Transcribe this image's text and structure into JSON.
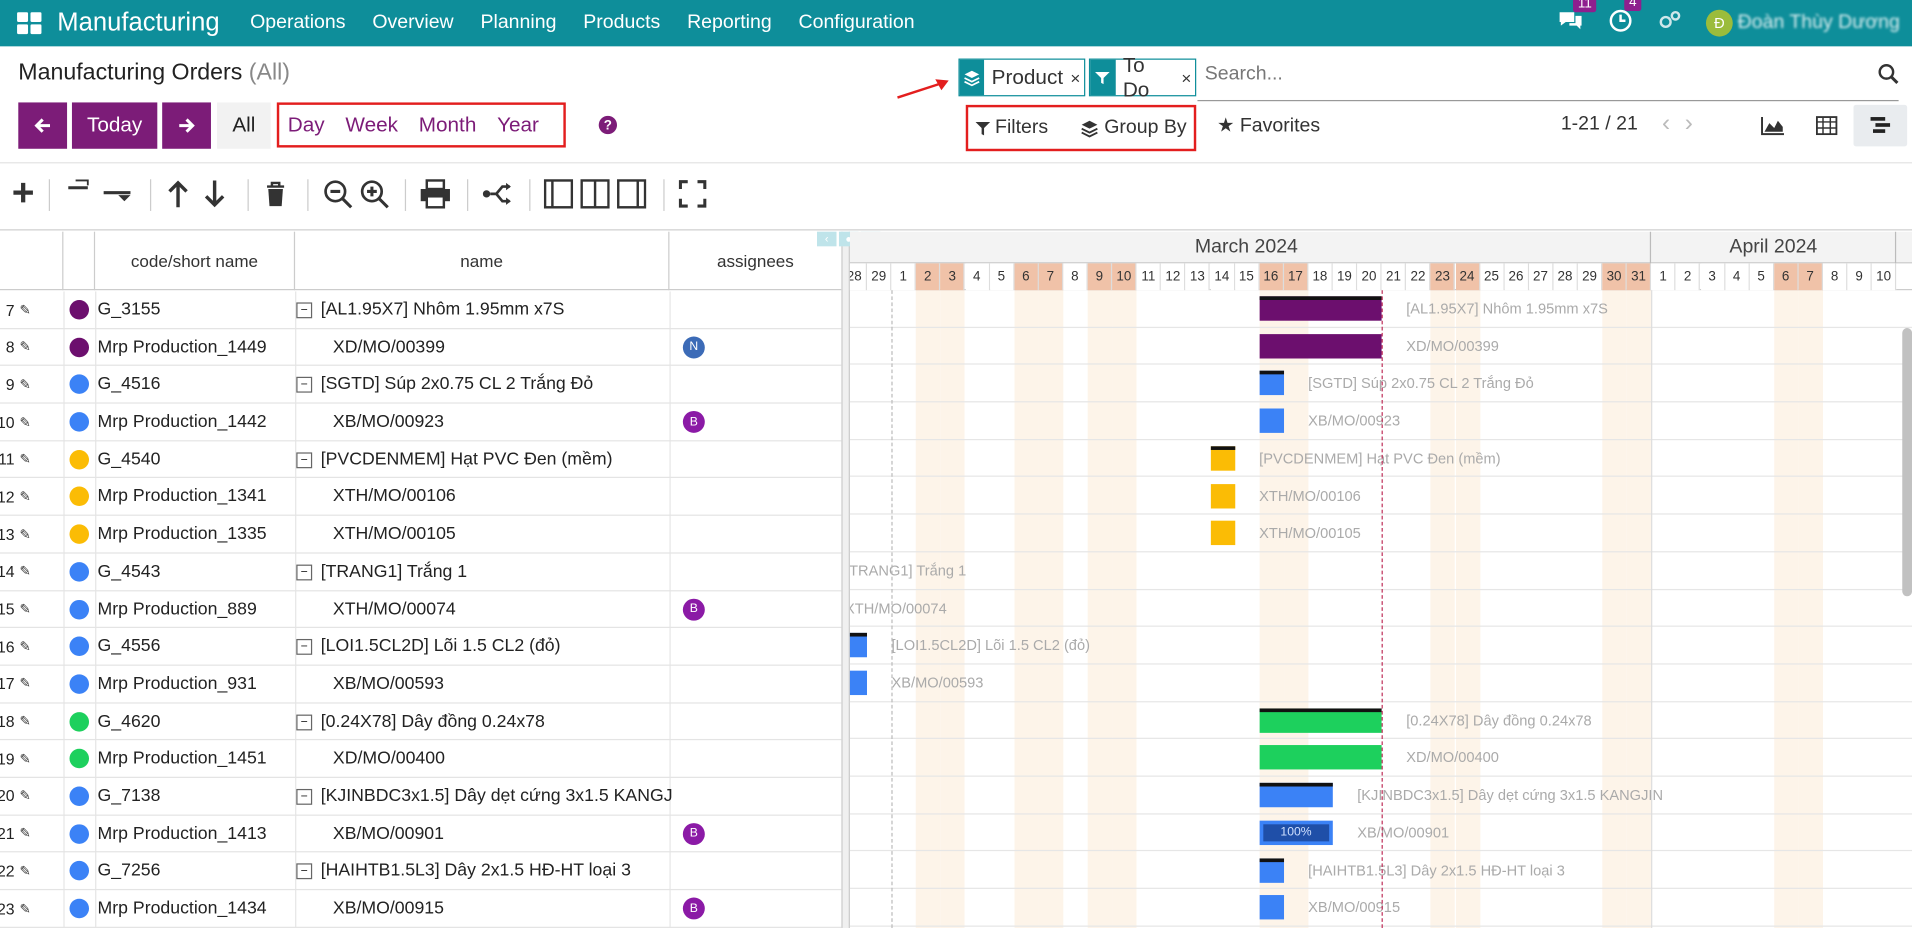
{
  "app": {
    "name": "Manufacturing",
    "menus": [
      "Operations",
      "Overview",
      "Planning",
      "Products",
      "Reporting",
      "Configuration"
    ]
  },
  "systray": {
    "messages_badge": "11",
    "activities_badge": "4",
    "user_initial": "Đ",
    "user_name": "Đoàn Thùy Dương"
  },
  "page": {
    "title": "Manufacturing Orders",
    "subtitle": "(All)"
  },
  "nav": {
    "today": "Today",
    "all": "All",
    "scales": [
      "Day",
      "Week",
      "Month",
      "Year"
    ],
    "help": "?"
  },
  "search": {
    "facets": [
      {
        "label": "Product",
        "icon": "layers-icon"
      },
      {
        "label": "To Do",
        "icon": "filter-icon"
      }
    ],
    "placeholder": "Search...",
    "filters": "Filters",
    "group_by": "Group By",
    "favorites": "Favorites"
  },
  "pager": {
    "text": "1-21 / 21"
  },
  "grid": {
    "headers": {
      "code": "code/short name",
      "name": "name",
      "assignees": "assignees"
    }
  },
  "rows": [
    {
      "n": "7",
      "code": "G_3155",
      "name": "[AL1.95X7] Nhôm 1.95mm x7S",
      "parent": true,
      "color": "#6c0f6e",
      "avatar": ""
    },
    {
      "n": "8",
      "code": "Mrp Production_1449",
      "name": "XD/MO/00399",
      "parent": false,
      "color": "#6c0f6e",
      "avatar": "N",
      "avatar_color": "#3c6bb7"
    },
    {
      "n": "9",
      "code": "G_4516",
      "name": "[SGTD] Súp 2x0.75 CL 2 Trắng Đỏ",
      "parent": true,
      "color": "#3b82f6",
      "avatar": ""
    },
    {
      "n": "10",
      "code": "Mrp Production_1442",
      "name": "XB/MO/00923",
      "parent": false,
      "color": "#3b82f6",
      "avatar": "B",
      "avatar_color": "#8b1aa6"
    },
    {
      "n": "11",
      "code": "G_4540",
      "name": "[PVCDENMEM] Hạt PVC Đen (mềm)",
      "parent": true,
      "color": "#fbbc05",
      "avatar": ""
    },
    {
      "n": "12",
      "code": "Mrp Production_1341",
      "name": "XTH/MO/00106",
      "parent": false,
      "color": "#fbbc05",
      "avatar": ""
    },
    {
      "n": "13",
      "code": "Mrp Production_1335",
      "name": "XTH/MO/00105",
      "parent": false,
      "color": "#fbbc05",
      "avatar": ""
    },
    {
      "n": "14",
      "code": "G_4543",
      "name": "[TRANG1] Trắng 1",
      "parent": true,
      "color": "#3b82f6",
      "avatar": ""
    },
    {
      "n": "15",
      "code": "Mrp Production_889",
      "name": "XTH/MO/00074",
      "parent": false,
      "color": "#3b82f6",
      "avatar": "B",
      "avatar_color": "#8b1aa6"
    },
    {
      "n": "16",
      "code": "G_4556",
      "name": "[LOI1.5CL2D] Lõi 1.5 CL2 (đỏ)",
      "parent": true,
      "color": "#3b82f6",
      "avatar": ""
    },
    {
      "n": "17",
      "code": "Mrp Production_931",
      "name": "XB/MO/00593",
      "parent": false,
      "color": "#3b82f6",
      "avatar": ""
    },
    {
      "n": "18",
      "code": "G_4620",
      "name": "[0.24X78] Dây đồng 0.24x78",
      "parent": true,
      "color": "#1dd05d",
      "avatar": ""
    },
    {
      "n": "19",
      "code": "Mrp Production_1451",
      "name": "XD/MO/00400",
      "parent": false,
      "color": "#1dd05d",
      "avatar": ""
    },
    {
      "n": "20",
      "code": "G_7138",
      "name": "[KJINBDC3x1.5] Dây dẹt cứng 3x1.5 KANGJ",
      "parent": true,
      "color": "#3b82f6",
      "avatar": ""
    },
    {
      "n": "21",
      "code": "Mrp Production_1413",
      "name": "XB/MO/00901",
      "parent": false,
      "color": "#3b82f6",
      "avatar": "B",
      "avatar_color": "#8b1aa6"
    },
    {
      "n": "22",
      "code": "G_7256",
      "name": "[HAIHTB1.5L3] Dây 2x1.5 HĐ-HT loại 3",
      "parent": true,
      "color": "#3b82f6",
      "avatar": ""
    },
    {
      "n": "23",
      "code": "Mrp Production_1434",
      "name": "XB/MO/00915",
      "parent": false,
      "color": "#3b82f6",
      "avatar": "B",
      "avatar_color": "#8b1aa6"
    }
  ],
  "timeline": {
    "months": [
      "March 2024",
      "April 2024"
    ],
    "days": [
      "28",
      "29",
      "1",
      "2",
      "3",
      "4",
      "5",
      "6",
      "7",
      "8",
      "9",
      "10",
      "11",
      "12",
      "13",
      "14",
      "15",
      "16",
      "17",
      "18",
      "19",
      "20",
      "21",
      "22",
      "23",
      "24",
      "25",
      "26",
      "27",
      "28",
      "29",
      "30",
      "31",
      "1",
      "2",
      "3",
      "4",
      "5",
      "6",
      "7",
      "8",
      "9",
      "10"
    ],
    "weekend_days": [
      "2",
      "3",
      "9",
      "10",
      "16",
      "17",
      "23",
      "24",
      "30",
      "31",
      "6",
      "7"
    ],
    "today_label": "21 March 2024"
  },
  "gantt_bars": [
    {
      "label": "[AL1.95X7] Nhôm 1.95mm x7S",
      "start": "2024-03-16",
      "end": "2024-03-20",
      "color": "#6c0f6e",
      "parent": true
    },
    {
      "label": "XD/MO/00399",
      "start": "2024-03-16",
      "end": "2024-03-20",
      "color": "#6c0f6e",
      "parent": false
    },
    {
      "label": "[SGTD] Súp 2x0.75 CL 2 Trắng Đỏ",
      "start": "2024-03-16",
      "end": "2024-03-16",
      "color": "#3b82f6",
      "parent": true
    },
    {
      "label": "XB/MO/00923",
      "start": "2024-03-16",
      "end": "2024-03-16",
      "color": "#3b82f6",
      "parent": false
    },
    {
      "label": "[PVCDENMEM] Hạt PVC Đen (mềm)",
      "start": "2024-03-14",
      "end": "2024-03-14",
      "color": "#fbbc05",
      "parent": true
    },
    {
      "label": "XTH/MO/00106",
      "start": "2024-03-14",
      "end": "2024-03-14",
      "color": "#fbbc05",
      "parent": false
    },
    {
      "label": "XTH/MO/00105",
      "start": "2024-03-14",
      "end": "2024-03-14",
      "color": "#fbbc05",
      "parent": false
    },
    {
      "label": "[TRANG1] Trắng 1",
      "start": "",
      "end": "",
      "color": "",
      "parent": true
    },
    {
      "label": "XTH/MO/00074",
      "start": "",
      "end": "",
      "color": "",
      "parent": false
    },
    {
      "label": "[LOI1.5CL2D] Lõi 1.5 CL2 (đỏ)",
      "start": "2024-02-28",
      "end": "2024-02-28",
      "color": "#3b82f6",
      "parent": true
    },
    {
      "label": "XB/MO/00593",
      "start": "2024-02-28",
      "end": "2024-02-28",
      "color": "#3b82f6",
      "parent": false
    },
    {
      "label": "[0.24X78] Dây đồng 0.24x78",
      "start": "2024-03-16",
      "end": "2024-03-20",
      "color": "#1dd05d",
      "parent": true
    },
    {
      "label": "XD/MO/00400",
      "start": "2024-03-16",
      "end": "2024-03-20",
      "color": "#1dd05d",
      "parent": false
    },
    {
      "label": "[KJINBDC3x1.5] Dây dẹt cứng 3x1.5 KANGJIN",
      "start": "2024-03-16",
      "end": "2024-03-18",
      "color": "#3b82f6",
      "parent": true
    },
    {
      "label": "XB/MO/00901",
      "start": "2024-03-16",
      "end": "2024-03-18",
      "color": "#3b82f6",
      "parent": false,
      "progress": "100%"
    },
    {
      "label": "[HAIHTB1.5L3] Dây 2x1.5 HĐ-HT loại 3",
      "start": "2024-03-16",
      "end": "2024-03-16",
      "color": "#3b82f6",
      "parent": true
    },
    {
      "label": "XB/MO/00915",
      "start": "2024-03-16",
      "end": "2024-03-16",
      "color": "#3b82f6",
      "parent": false
    }
  ]
}
